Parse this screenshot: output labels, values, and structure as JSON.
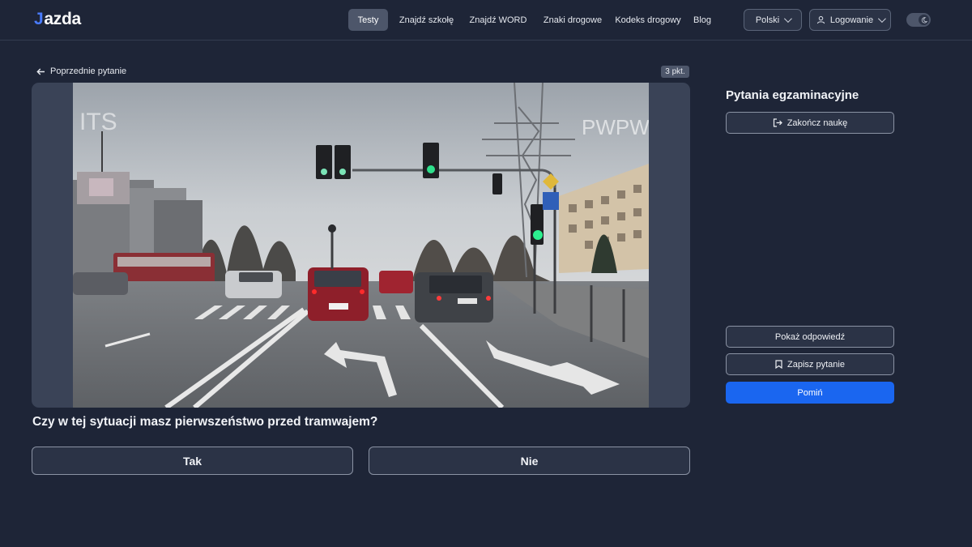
{
  "header": {
    "logo_mark": "J",
    "logo_text": "azda",
    "nav": [
      {
        "label": "Testy",
        "active": true
      },
      {
        "label": "Znajdź szkołę",
        "active": false
      },
      {
        "label": "Znajdź WORD",
        "active": false
      },
      {
        "label": "Znaki drogowe",
        "active": false
      },
      {
        "label": "Kodeks drogowy",
        "active": false
      },
      {
        "label": "Blog",
        "active": false
      }
    ],
    "language": "Polski",
    "login": "Logowanie",
    "theme_icon": "moon-icon"
  },
  "question_panel": {
    "back_label": "Poprzednie pytanie",
    "points": "3 pkt.",
    "media": {
      "watermark_left": "ITS",
      "watermark_right": "PWPW"
    },
    "question": "Czy w tej sytuacji masz pierwszeństwo przed tramwajem?",
    "answers": [
      "Tak",
      "Nie"
    ]
  },
  "sidebar": {
    "title": "Pytania egzaminacyjne",
    "finish_label": "Zakończ naukę",
    "show_answer_label": "Pokaż odpowiedź",
    "save_label": "Zapisz pytanie",
    "skip_label": "Pomiń"
  },
  "colors": {
    "background": "#1e2537",
    "accent": "#1a66f0",
    "logo_mark": "#4a7cff"
  }
}
